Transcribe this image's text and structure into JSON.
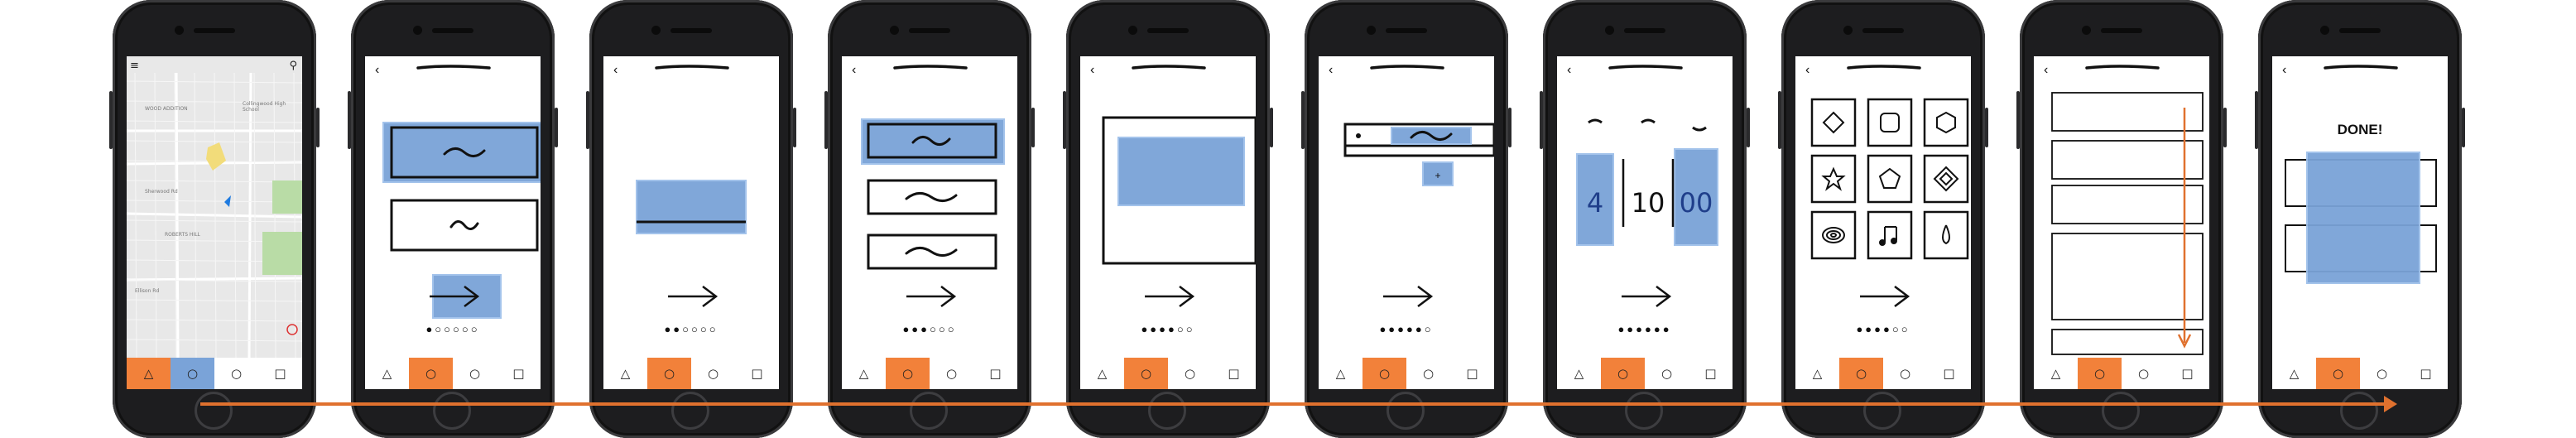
{
  "colors": {
    "accent_orange": "#f2813a",
    "highlight_blue": "#7aa3d8",
    "phone_body": "#1d1d1f",
    "map_bg": "#e8e8e8",
    "map_park": "#b9dca6"
  },
  "icons": {
    "menu": "menu-icon",
    "search": "search-icon",
    "back": "back-chevron-icon",
    "next": "next-arrow-icon",
    "nav_triangle": "triangle-icon",
    "nav_circle": "circle-icon",
    "nav_square": "square-icon"
  },
  "glyphs": {
    "menu": "≡",
    "search": "⚲",
    "back": "‹",
    "triangle": "△",
    "circle": "○",
    "square": "□"
  },
  "map": {
    "labels": [
      "WOOD ADDITION",
      "Collingwood High School",
      "ROBERTS HILL",
      "Sherwood Rd",
      "Ellison Rd"
    ]
  },
  "phones": [
    {
      "id": "map",
      "active_nav": 1,
      "pager": ""
    },
    {
      "id": "option-select",
      "active_nav": 1,
      "pager": "●○○○○○"
    },
    {
      "id": "single-bar",
      "active_nav": 1,
      "pager": "●●○○○○"
    },
    {
      "id": "option-select-2",
      "active_nav": 1,
      "pager": "●●●○○○"
    },
    {
      "id": "image-panel",
      "active_nav": 1,
      "pager": "●●●●○○"
    },
    {
      "id": "add-item",
      "active_nav": 1,
      "pager": "●●●●●○"
    },
    {
      "id": "time-picker",
      "active_nav": 1,
      "pager": "●●●●●●",
      "time": {
        "hour": "4",
        "minute": "10",
        "second": "00"
      }
    },
    {
      "id": "icon-grid",
      "active_nav": 1,
      "pager": "●●●●○○"
    },
    {
      "id": "scroll-list",
      "active_nav": 1,
      "pager": ""
    },
    {
      "id": "done",
      "active_nav": 1,
      "pager": "",
      "done_label": "DONE!"
    }
  ]
}
